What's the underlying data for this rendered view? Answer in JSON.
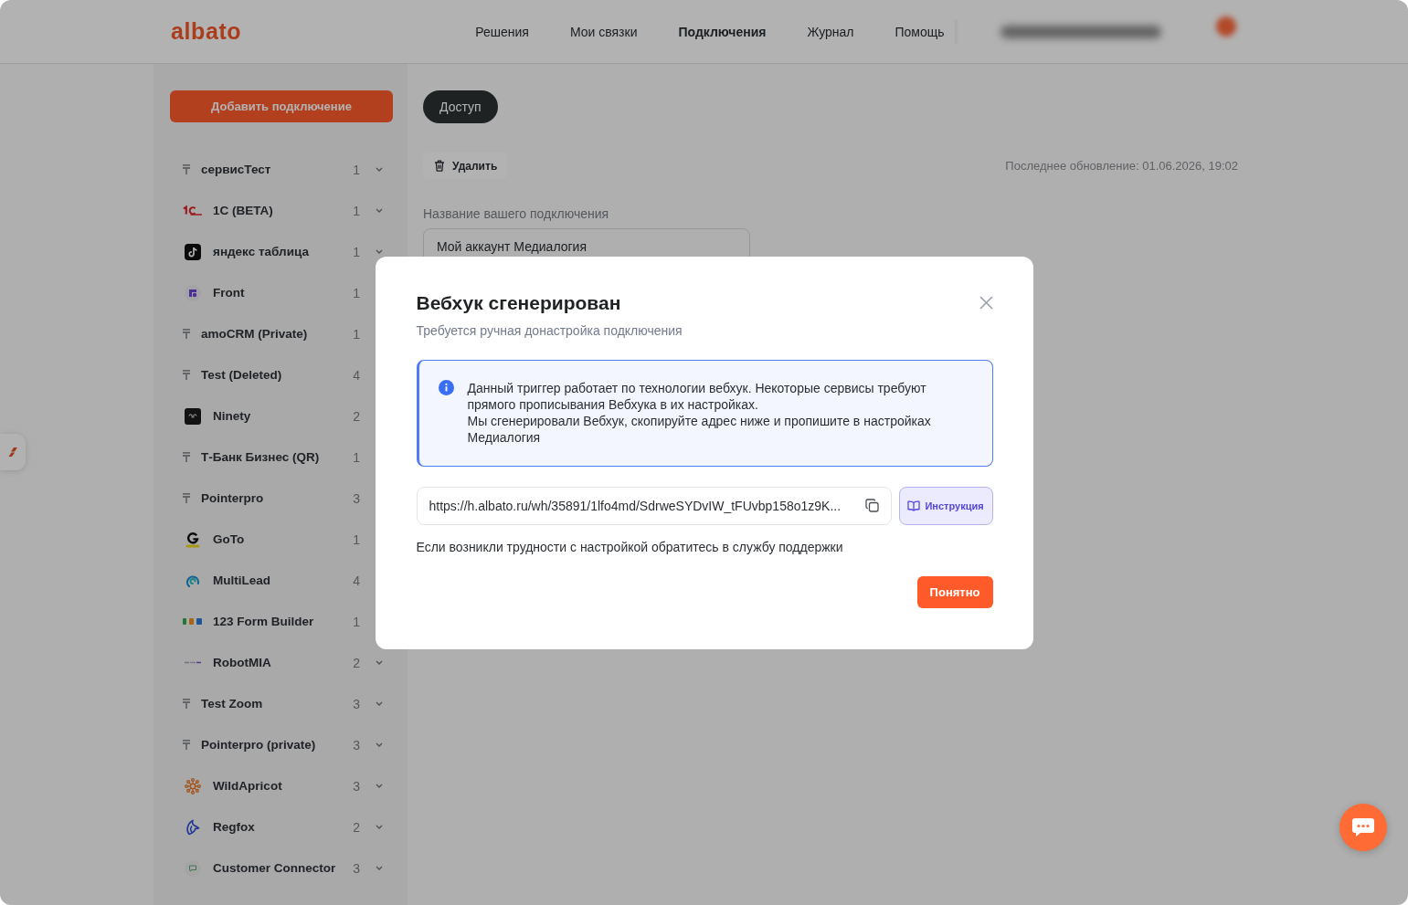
{
  "header": {
    "logo": "albato",
    "nav": [
      {
        "label": "Решения",
        "selected": false
      },
      {
        "label": "Мои связки",
        "selected": false
      },
      {
        "label": "Подключения",
        "selected": true
      },
      {
        "label": "Журнал",
        "selected": false
      },
      {
        "label": "Помощь",
        "selected": false
      }
    ]
  },
  "sidebar": {
    "add_button": "Добавить подключение",
    "items": [
      {
        "name": "сервисТест",
        "count": "1",
        "kind": "generic",
        "expandable": true
      },
      {
        "name": "1С (BETA)",
        "count": "1",
        "kind": "swoosh",
        "expandable": true
      },
      {
        "name": "яндекс таблица",
        "count": "1",
        "kind": "note",
        "expandable": true
      },
      {
        "name": "Front",
        "count": "1",
        "kind": "squaredot"
      },
      {
        "name": "amoCRM (Private)",
        "count": "1",
        "kind": "generic"
      },
      {
        "name": "Test (Deleted)",
        "count": "4",
        "kind": "generic"
      },
      {
        "name": "Ninety",
        "count": "2",
        "kind": "square"
      },
      {
        "name": "Т-Банк Бизнес (QR)",
        "count": "1",
        "kind": "generic"
      },
      {
        "name": "Pointerpro",
        "count": "3",
        "kind": "generic"
      },
      {
        "name": "GoTo",
        "count": "1",
        "kind": "gletter"
      },
      {
        "name": "MultiLead",
        "count": "4",
        "kind": "swirl"
      },
      {
        "name": "123 Form Builder",
        "count": "1",
        "kind": "blocks"
      },
      {
        "name": "RobotMIA",
        "count": "2",
        "kind": "dashes",
        "expandable": true
      },
      {
        "name": "Test Zoom",
        "count": "3",
        "kind": "generic",
        "expandable": true
      },
      {
        "name": "Pointerpro (private)",
        "count": "3",
        "kind": "generic",
        "expandable": true
      },
      {
        "name": "WildApricot",
        "count": "3",
        "kind": "flower",
        "expandable": true
      },
      {
        "name": "Regfox",
        "count": "2",
        "kind": "curve",
        "expandable": true
      },
      {
        "name": "Customer Connector",
        "count": "3",
        "kind": "bubble",
        "expandable": true
      }
    ]
  },
  "main": {
    "access_button": "Доступ",
    "delete_button": "Удалить",
    "last_updated": "Последнее обновление: 01.06.2026, 19:02",
    "name_field": {
      "label": "Название вашего подключения",
      "value": "Мой аккаунт Медиалогия"
    }
  },
  "modal": {
    "title": "Вебхук сгенерирован",
    "subtitle": "Требуется ручная донастройка подключения",
    "info": [
      "Данный триггер работает по технологии вебхук. Некоторые сервисы требуют прямого прописывания Вебхука в их настройках.",
      "Мы сгенерировали Вебхук, скопируйте адрес ниже и пропишите в настройках Медиалогия"
    ],
    "webhook_url": "https://h.albato.ru/wh/35891/1lfo4md/SdrweSYDvIW_tFUvbp158o1z9K...",
    "instruction_button": "Инструкция",
    "help_text": "Если возникли трудности с настройкой обратитесь в службу поддержки",
    "ok_button": "Понятно"
  }
}
